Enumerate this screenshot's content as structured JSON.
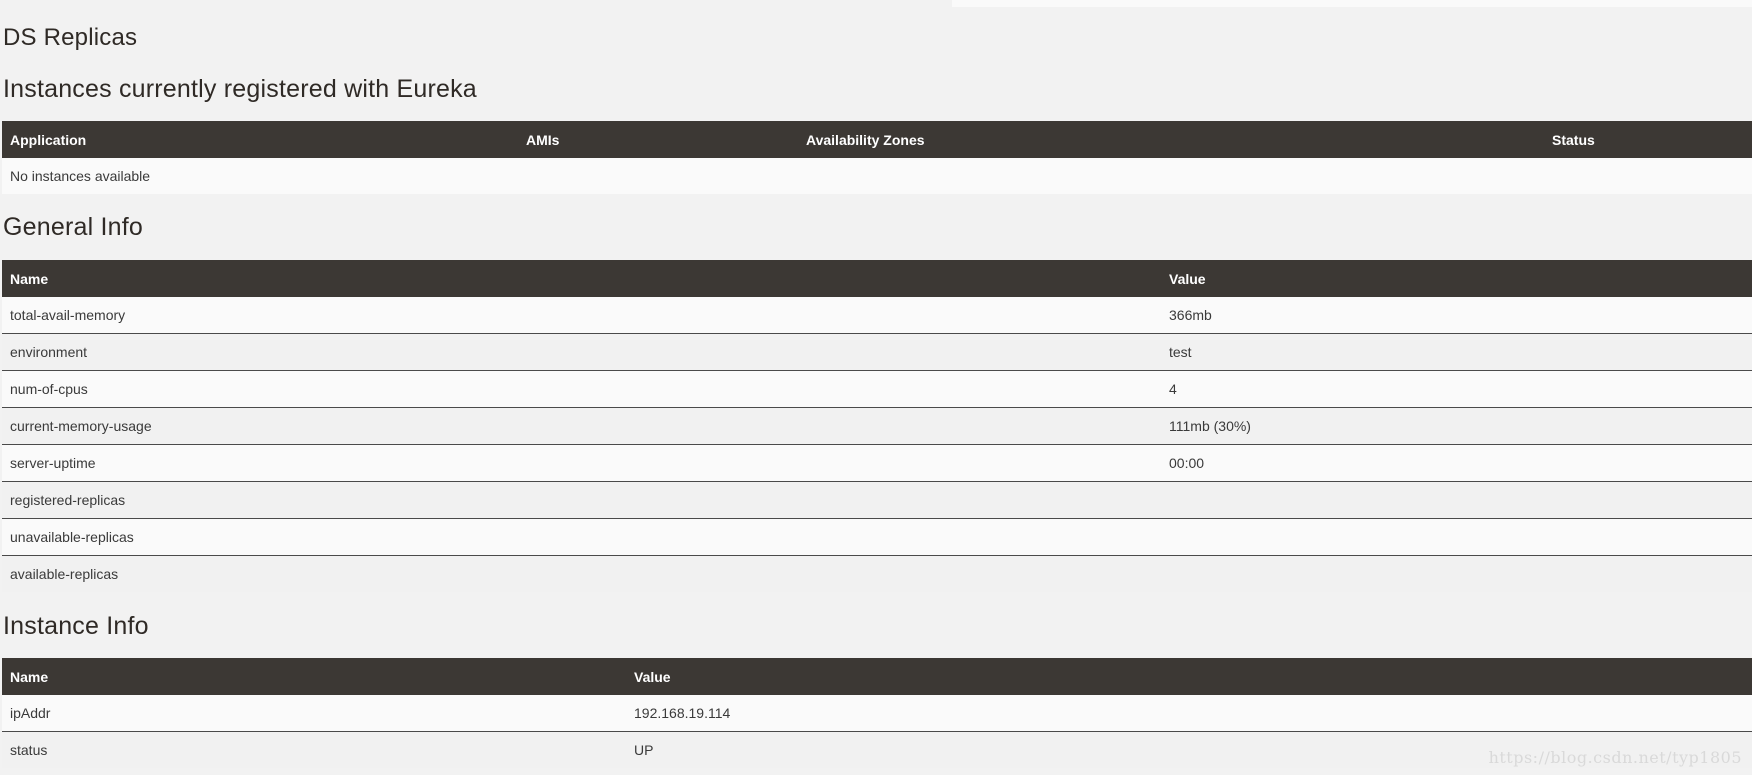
{
  "sections": {
    "ds_replicas": "DS Replicas",
    "instances_title": "Instances currently registered with Eureka",
    "general_title": "General Info",
    "instance_info_title": "Instance Info"
  },
  "instances_table": {
    "headers": [
      "Application",
      "AMIs",
      "Availability Zones",
      "Status"
    ],
    "empty_message": "No instances available"
  },
  "general_table": {
    "headers": [
      "Name",
      "Value"
    ],
    "rows": [
      {
        "name": "total-avail-memory",
        "value": "366mb"
      },
      {
        "name": "environment",
        "value": "test"
      },
      {
        "name": "num-of-cpus",
        "value": "4"
      },
      {
        "name": "current-memory-usage",
        "value": "111mb (30%)"
      },
      {
        "name": "server-uptime",
        "value": "00:00"
      },
      {
        "name": "registered-replicas",
        "value": ""
      },
      {
        "name": "unavailable-replicas",
        "value": ""
      },
      {
        "name": "available-replicas",
        "value": ""
      }
    ]
  },
  "instance_info_table": {
    "headers": [
      "Name",
      "Value"
    ],
    "rows": [
      {
        "name": "ipAddr",
        "value": "192.168.19.114"
      },
      {
        "name": "status",
        "value": "UP"
      }
    ]
  },
  "watermark": "https://blog.csdn.net/typ1805",
  "colors": {
    "page_background": "#f2f2f2",
    "table_header": "#3c3834",
    "heading_text": "#2f2a26"
  }
}
